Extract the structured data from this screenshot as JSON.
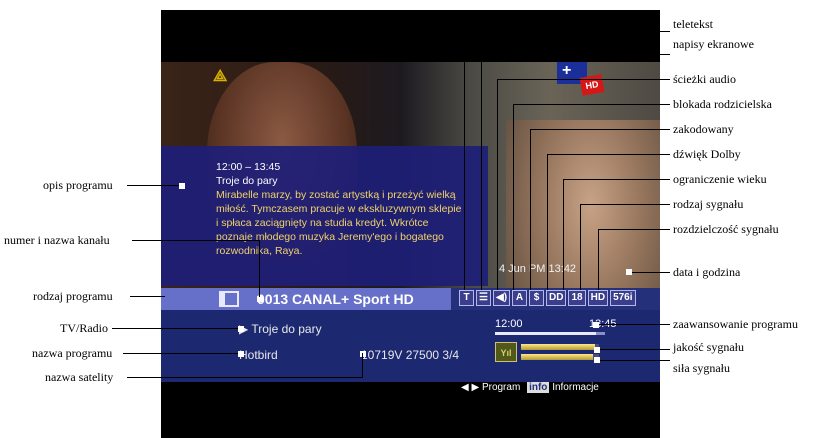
{
  "tv": {
    "info": {
      "time": "12:00 – 13:45",
      "title": "Troje do pary",
      "description": "Mirabelle marzy, by zostać artystką i przeżyć wielką miłość. Tymczasem pracuje w ekskluzywnym sklepie i spłaca zaciągnięty na studia kredyt. Wkrótce poznaje młodego muzyka Jeremy'ego i bogatego rozwodnika, Raya."
    },
    "datetime": "4 Jun PM 13:42",
    "channel": "0013 CANAL+ Sport HD",
    "icons": [
      "T",
      "☰",
      "◀)",
      "A",
      "$",
      "DD",
      "18",
      "HD",
      "576i"
    ],
    "tv_radio_label": "▶ Troje do pary",
    "satellite": "Hotbird",
    "frequency": "10719V 27500 3/4",
    "time_start": "12:00",
    "time_end": "13:45",
    "progress_fraction": 0.92,
    "signal_quality_fraction": 0.95,
    "signal_strength_fraction": 0.92,
    "signal_icon_text": "Yıl",
    "nav_program": "◀ ▶ Program",
    "nav_info_key": "info",
    "nav_info_label": "Informacje",
    "ch_logo_plus": "+",
    "hd_badge": "HD"
  },
  "annotations_left": {
    "opis_programu": "opis programu",
    "numer_nazwa": "numer i nazwa kanału",
    "rodzaj_programu": "rodzaj programu",
    "tv_radio": "TV/Radio",
    "nazwa_programu": "nazwa programu",
    "nazwa_satelity": "nazwa satelity"
  },
  "annotations_right": {
    "teletekst": "teletekst",
    "napisy": "napisy ekranowe",
    "sciezki": "ścieżki audio",
    "blokada": "blokada rodzicielska",
    "zakodowany": "zakodowany",
    "dolby": "dźwięk Dolby",
    "ograniczenie": "ograniczenie wieku",
    "rodzaj_sygnalu": "rodzaj sygnału",
    "rozdzielczosc": "rozdzielczość sygnału",
    "data_godzina": "data i godzina",
    "zaawansowanie": "zaawansowanie programu",
    "jakosc": "jakość sygnału",
    "sila": "siła sygnału"
  }
}
